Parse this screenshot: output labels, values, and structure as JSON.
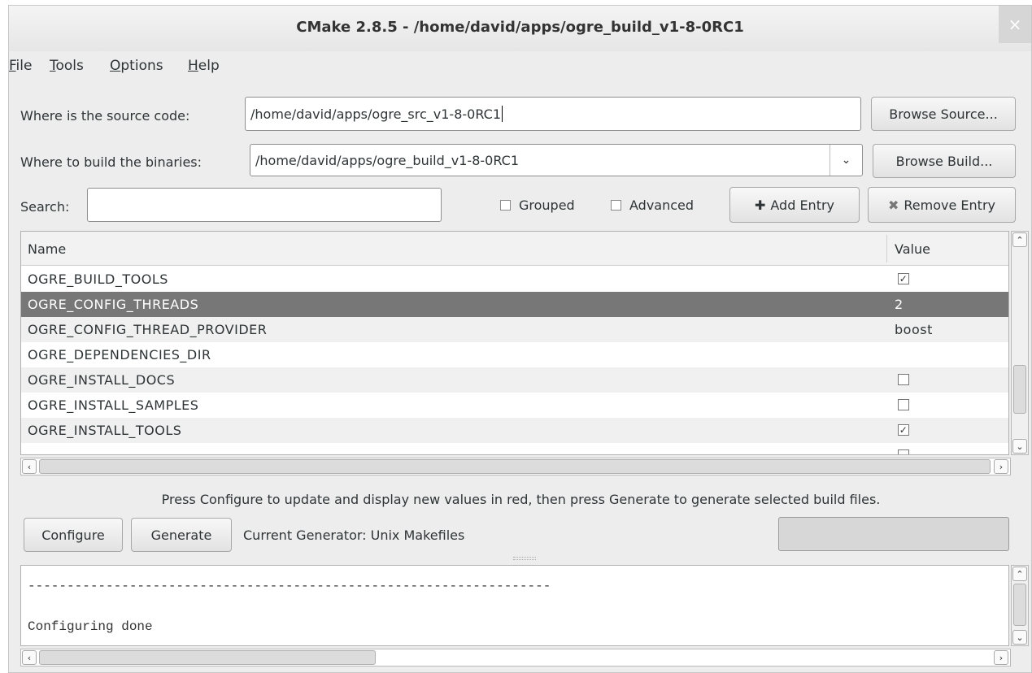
{
  "window": {
    "title": "CMake 2.8.5 - /home/david/apps/ogre_build_v1-8-0RC1",
    "close_icon": "×"
  },
  "menu": {
    "file": "File",
    "tools": "Tools",
    "options": "Options",
    "help": "Help"
  },
  "source": {
    "label": "Where is the source code:",
    "value": "/home/david/apps/ogre_src_v1-8-0RC1",
    "browse_label": "Browse Source..."
  },
  "build": {
    "label": "Where to build the binaries:",
    "value": "/home/david/apps/ogre_build_v1-8-0RC1",
    "browse_label": "Browse Build..."
  },
  "search": {
    "label": "Search:",
    "value": ""
  },
  "options": {
    "grouped_label": "Grouped",
    "grouped_checked": false,
    "advanced_label": "Advanced",
    "advanced_checked": false,
    "add_entry_label": "Add Entry",
    "remove_entry_label": "Remove Entry"
  },
  "table": {
    "col_name": "Name",
    "col_value": "Value",
    "rows": [
      {
        "name": "OGRE_BUILD_TOOLS",
        "type": "bool",
        "checked": true
      },
      {
        "name": "OGRE_CONFIG_THREADS",
        "type": "text",
        "value": "2",
        "selected": true
      },
      {
        "name": "OGRE_CONFIG_THREAD_PROVIDER",
        "type": "text",
        "value": "boost"
      },
      {
        "name": "OGRE_DEPENDENCIES_DIR",
        "type": "text",
        "value": ""
      },
      {
        "name": "OGRE_INSTALL_DOCS",
        "type": "bool",
        "checked": false
      },
      {
        "name": "OGRE_INSTALL_SAMPLES",
        "type": "bool",
        "checked": false
      },
      {
        "name": "OGRE_INSTALL_TOOLS",
        "type": "bool",
        "checked": true
      }
    ]
  },
  "hint": "Press Configure to update and display new values in red, then press Generate to generate selected build files.",
  "actions": {
    "configure_label": "Configure",
    "generate_label": "Generate",
    "generator_text": "Current Generator: Unix Makefiles"
  },
  "output": {
    "lines": [
      "-------------------------------------------------------------------",
      "",
      "Configuring done"
    ]
  }
}
